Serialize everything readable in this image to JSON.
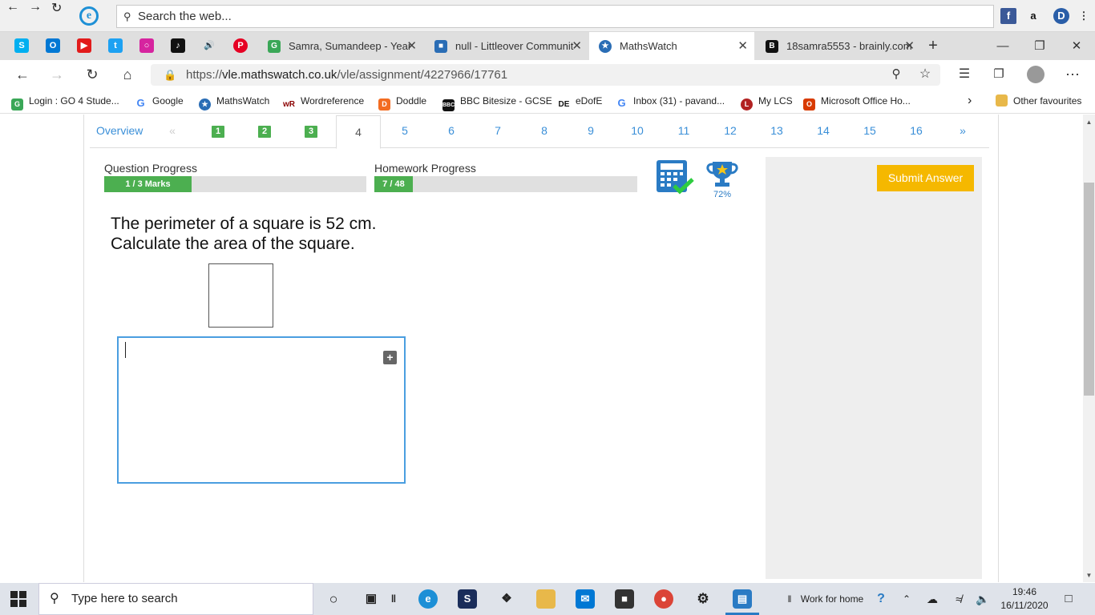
{
  "ie_toolbar": {
    "search_placeholder": "Search the web..."
  },
  "tabs": [
    {
      "label": "Samra, Sumandeep - Year"
    },
    {
      "label": "null - Littleover Communit"
    },
    {
      "label": "MathsWatch",
      "active": true
    },
    {
      "label": "18samra5553 - brainly.com"
    }
  ],
  "address": {
    "url_prefix": "https://",
    "url_domain": "vle.mathswatch.co.uk",
    "url_path": "/vle/assignment/4227966/17761"
  },
  "favourites": [
    {
      "label": "Login : GO 4 Stude...",
      "icon": "go4schools-icon",
      "color": "#3aa757"
    },
    {
      "label": "Google",
      "icon": "google-icon",
      "color": "#4285f4"
    },
    {
      "label": "MathsWatch",
      "icon": "mathswatch-icon",
      "color": "#2a6db5"
    },
    {
      "label": "Wordreference",
      "icon": "wordreference-icon",
      "color": "#333"
    },
    {
      "label": "Doddle",
      "icon": "doddle-icon",
      "color": "#f36c21"
    },
    {
      "label": "BBC Bitesize - GCSE",
      "icon": "bbc-icon",
      "color": "#000"
    },
    {
      "label": "eDofE",
      "icon": "edofe-icon",
      "color": "#222"
    },
    {
      "label": "Inbox (31) - pavand...",
      "icon": "google-icon",
      "color": "#4285f4"
    },
    {
      "label": "My LCS",
      "icon": "mylcs-icon",
      "color": "#b22222"
    },
    {
      "label": "Microsoft Office Ho...",
      "icon": "office-icon",
      "color": "#d83b01"
    }
  ],
  "other_favourites": "Other favourites",
  "question_nav": {
    "overview": "Overview",
    "prev": "«",
    "done": [
      "1",
      "2",
      "3"
    ],
    "current": "4",
    "pending": [
      "5",
      "6",
      "7",
      "8",
      "9",
      "10",
      "11",
      "12",
      "13",
      "14",
      "15",
      "16"
    ],
    "next": "»"
  },
  "progress": {
    "question_label": "Question Progress",
    "question_text": "1 / 3 Marks",
    "question_fraction": 0.333,
    "homework_label": "Homework Progress",
    "homework_text": "7 / 48",
    "homework_fraction": 0.146,
    "trophy_percent": "72%"
  },
  "question": {
    "line1": "The perimeter of a square is 52 cm.",
    "line2": "Calculate the area of the square."
  },
  "submit_label": "Submit Answer",
  "taskbar": {
    "search_placeholder": "Type here to search",
    "work_label": "Work for home",
    "time": "19:46",
    "date": "16/11/2020"
  }
}
